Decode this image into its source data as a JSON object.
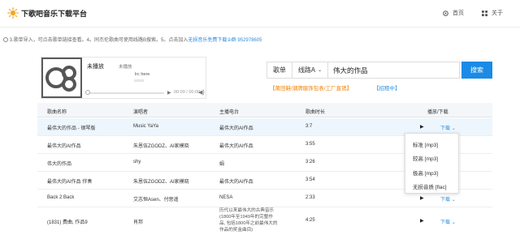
{
  "header": {
    "site_title": "下歌吧音乐下载平台",
    "nav_home": "首页",
    "nav_about": "关于"
  },
  "notice": {
    "text": "3.歌单导入，可点击歌单链接查看。4。同杰伦歌曲可使用线路B搜索。5。点击加入",
    "link": "无损音乐免费下载②群 952978605"
  },
  "player": {
    "song_title": "未播放",
    "artist": "未播放",
    "lyric_line1": "lrc here",
    "lyric_line2": "xxxxx",
    "progress": 0,
    "time": "00:00 / 00:00"
  },
  "search": {
    "type_label": "歌单",
    "line_label": "线路A",
    "query": "伟大的作品",
    "button_label": "搜索",
    "promo": "【莆田鞋/潮牌服饰包表/工厂直销】",
    "promo2": "【招租中】"
  },
  "table": {
    "headers": [
      "歌曲名称",
      "演唱者",
      "主播电台",
      "歌曲时长",
      "播放/下载"
    ],
    "rows": [
      {
        "title": "最伟大的作品 - 钢琴版",
        "artist": "Music YaYa",
        "album": "最伟大的AI作品",
        "duration": "3:7",
        "download": "下载"
      },
      {
        "title": "最伟大的AI作品",
        "artist": "朱恩伍ZGODZ、AI家模晓",
        "album": "最伟大的AI作品",
        "duration": "3:55",
        "download": ""
      },
      {
        "title": "伟大的作品",
        "artist": "shy",
        "album": "娟",
        "duration": "3:26",
        "download": ""
      },
      {
        "title": "最伟大的AI作品 伴奏",
        "artist": "朱恩伍ZGODZ、AI家模晓",
        "album": "最伟大的AI作品",
        "duration": "3:54",
        "download": ""
      },
      {
        "title": "Back 2 Back",
        "artist": "艾志恒Asen、付思遥",
        "album": "NESA",
        "duration": "2:33",
        "download": "下载"
      },
      {
        "title": "(1831) 费曲, 作品9",
        "artist": "肖邦",
        "album": "历代以来最伟大的古典音乐 (1800年至1949年的完整作品, 包括1800年之前最伟大的作品的奖金曲目)",
        "duration": "4:25",
        "download": "下载"
      }
    ]
  },
  "dropdown": {
    "items": [
      "标准 [mp3]",
      "较高 [mp3]",
      "极高 [mp3]",
      "无损音质 [flac]"
    ]
  },
  "colors": {
    "accent": "#1a8be6",
    "promo": "#f08300",
    "link": "#2b8ce0"
  }
}
